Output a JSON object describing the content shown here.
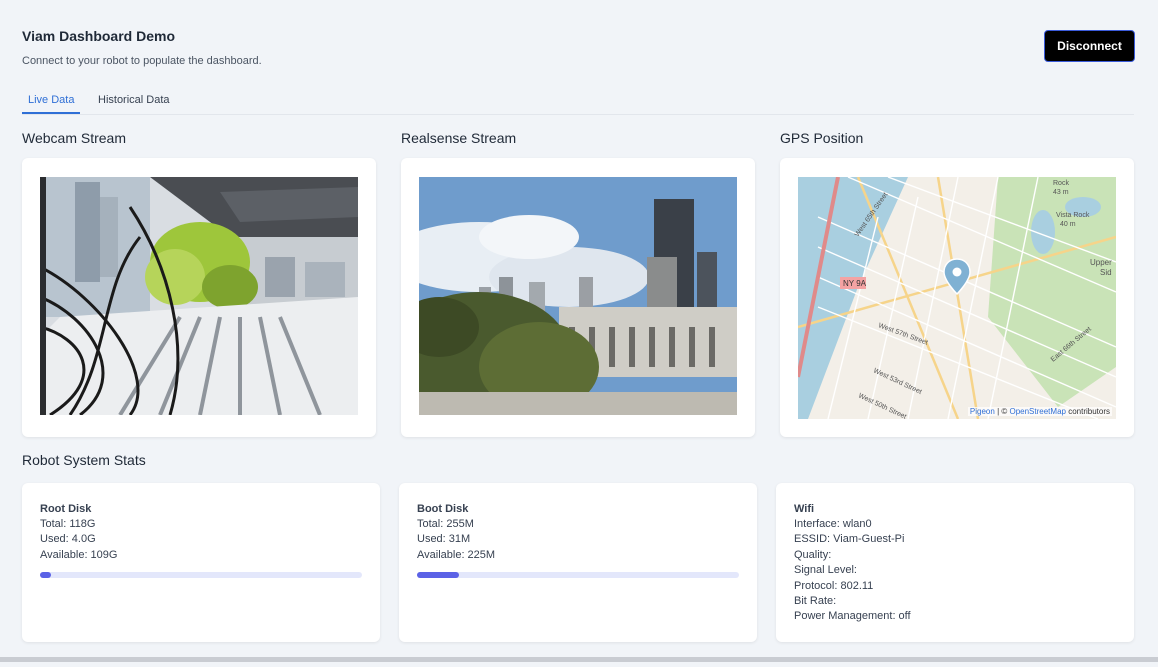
{
  "app": {
    "title": "Viam Dashboard Demo",
    "subtitle": "Connect to your robot to populate the dashboard.",
    "disconnect_label": "Disconnect"
  },
  "tabs": [
    {
      "label": "Live Data",
      "active": true
    },
    {
      "label": "Historical Data",
      "active": false
    }
  ],
  "streams": {
    "webcam_title": "Webcam Stream",
    "realsense_title": "Realsense Stream",
    "gps_title": "GPS Position"
  },
  "map": {
    "attribution_pigeon": "Pigeon",
    "attribution_sep": " | © ",
    "attribution_osm": "OpenStreetMap",
    "attribution_suffix": " contributors",
    "labels": {
      "ny9a": "NY 9A",
      "w65": "West 65th Street",
      "w57": "West 57th Street",
      "w53": "West 53rd Street",
      "w50": "West 50th Street",
      "e66": "East 66th Street",
      "rock": "Rock",
      "rock_m": "43 m",
      "vista": "Vista Rock",
      "vista_m": "40 m",
      "upper": "Upper",
      "side": "Sid"
    }
  },
  "stats": {
    "title": "Robot System Stats",
    "root_disk": {
      "name": "Root Disk",
      "total": "Total: 118G",
      "used": "Used: 4.0G",
      "available": "Available: 109G",
      "usage_fraction": 0.035
    },
    "boot_disk": {
      "name": "Boot Disk",
      "total": "Total: 255M",
      "used": "Used: 31M",
      "available": "Available: 225M",
      "usage_fraction": 0.13
    },
    "wifi": {
      "name": "Wifi",
      "interface": "Interface: wlan0",
      "essid": "ESSID: Viam-Guest-Pi",
      "quality": "Quality:",
      "signal": "Signal Level:",
      "protocol": "Protocol: 802.11",
      "bitrate": "Bit Rate:",
      "power": "Power Management: off"
    }
  },
  "colors": {
    "accent": "#2f6fd6",
    "progress": "#5b62e6",
    "progress_track": "#e3e7fb",
    "page_bg": "#f1f4f8"
  }
}
